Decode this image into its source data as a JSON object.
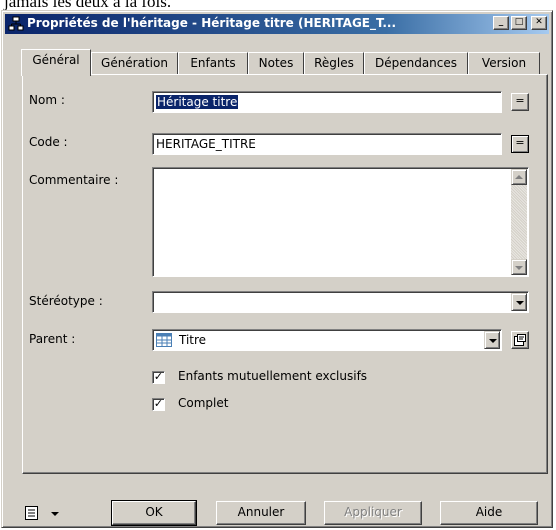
{
  "above_text": "jamais les deux à la fois.",
  "window": {
    "title": "Propriétés de l'héritage - Héritage titre (HERITAGE_T...",
    "min_label": "_",
    "max_label": "□",
    "close_label": "✕"
  },
  "tabs": [
    {
      "label": "Général",
      "active": true
    },
    {
      "label": "Génération"
    },
    {
      "label": "Enfants"
    },
    {
      "label": "Notes"
    },
    {
      "label": "Règles"
    },
    {
      "label": "Dépendances"
    },
    {
      "label": "Version"
    }
  ],
  "form": {
    "nom_label": "Nom :",
    "nom_value": "Héritage titre",
    "code_label": "Code :",
    "code_value": "HERITAGE_TITRE",
    "eq_label": "=",
    "commentaire_label": "Commentaire :",
    "commentaire_value": "",
    "stereotype_label": "Stéréotype :",
    "stereotype_value": "",
    "parent_label": "Parent :",
    "parent_value": "Titre",
    "check_exclusifs_label": "Enfants mutuellement exclusifs",
    "check_exclusifs_checked": true,
    "check_complet_label": "Complet",
    "check_complet_checked": true
  },
  "buttons": {
    "ok": "OK",
    "cancel": "Annuler",
    "apply": "Appliquer",
    "help": "Aide"
  },
  "colors": {
    "title_gradient_start": "#0a246a",
    "face": "#d4d0c8",
    "selection": "#0a246a"
  }
}
